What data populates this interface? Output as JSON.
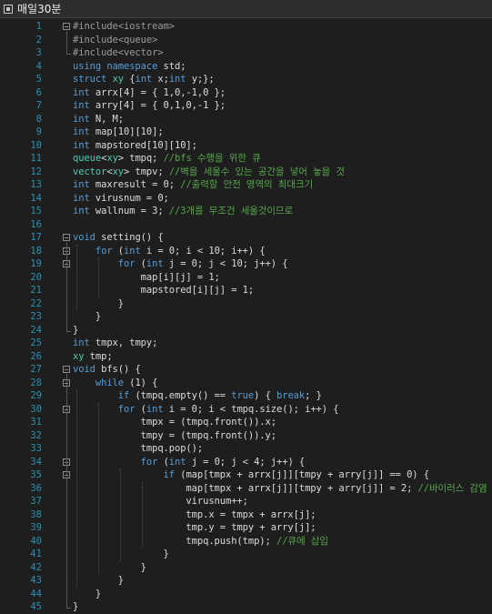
{
  "window": {
    "title": "매일30분"
  },
  "lines": [
    {
      "n": "1",
      "tokens": [
        {
          "t": "#include<iostream>",
          "c": "pp"
        }
      ]
    },
    {
      "n": "2",
      "tokens": [
        {
          "t": "#include<queue>",
          "c": "pp"
        }
      ]
    },
    {
      "n": "3",
      "tokens": [
        {
          "t": "#include<vector>",
          "c": "pp"
        }
      ]
    },
    {
      "n": "4",
      "tokens": [
        {
          "t": "using namespace ",
          "c": "kw"
        },
        {
          "t": "std;",
          "c": "id"
        }
      ]
    },
    {
      "n": "5",
      "tokens": [
        {
          "t": "struct ",
          "c": "kw"
        },
        {
          "t": "xy",
          "c": "ty"
        },
        {
          "t": " {",
          "c": "id"
        },
        {
          "t": "int ",
          "c": "kw"
        },
        {
          "t": "x;",
          "c": "id"
        },
        {
          "t": "int ",
          "c": "kw"
        },
        {
          "t": "y;};",
          "c": "id"
        }
      ]
    },
    {
      "n": "6",
      "tokens": [
        {
          "t": "int ",
          "c": "kw"
        },
        {
          "t": "arrx[4] = { 1,0,-1,0 };",
          "c": "id"
        }
      ]
    },
    {
      "n": "7",
      "tokens": [
        {
          "t": "int ",
          "c": "kw"
        },
        {
          "t": "arry[4] = { 0,1,0,-1 };",
          "c": "id"
        }
      ]
    },
    {
      "n": "8",
      "tokens": [
        {
          "t": "int ",
          "c": "kw"
        },
        {
          "t": "N, M;",
          "c": "id"
        }
      ]
    },
    {
      "n": "9",
      "tokens": [
        {
          "t": "int ",
          "c": "kw"
        },
        {
          "t": "map[10][10];",
          "c": "id"
        }
      ]
    },
    {
      "n": "10",
      "tokens": [
        {
          "t": "int ",
          "c": "kw"
        },
        {
          "t": "mapstored[10][10];",
          "c": "id"
        }
      ]
    },
    {
      "n": "11",
      "tokens": [
        {
          "t": "queue",
          "c": "ty"
        },
        {
          "t": "<",
          "c": "id"
        },
        {
          "t": "xy",
          "c": "ty"
        },
        {
          "t": "> tmpq; ",
          "c": "id"
        },
        {
          "t": "//bfs 수행을 위한 큐",
          "c": "cm"
        }
      ]
    },
    {
      "n": "12",
      "tokens": [
        {
          "t": "vector",
          "c": "ty"
        },
        {
          "t": "<",
          "c": "id"
        },
        {
          "t": "xy",
          "c": "ty"
        },
        {
          "t": "> tmpv; ",
          "c": "id"
        },
        {
          "t": "//벽을 세울수 있는 공간을 넣어 놓을 것",
          "c": "cm"
        }
      ]
    },
    {
      "n": "13",
      "tokens": [
        {
          "t": "int ",
          "c": "kw"
        },
        {
          "t": "maxresult = 0; ",
          "c": "id"
        },
        {
          "t": "//출력할 안전 영역의 최대크기",
          "c": "cm"
        }
      ]
    },
    {
      "n": "14",
      "tokens": [
        {
          "t": "int ",
          "c": "kw"
        },
        {
          "t": "virusnum = 0;",
          "c": "id"
        }
      ]
    },
    {
      "n": "15",
      "tokens": [
        {
          "t": "int ",
          "c": "kw"
        },
        {
          "t": "wallnum = 3; ",
          "c": "id"
        },
        {
          "t": "//3개를 무조건 세울것이므로",
          "c": "cm"
        }
      ]
    },
    {
      "n": "16",
      "tokens": []
    },
    {
      "n": "17",
      "tokens": [
        {
          "t": "void ",
          "c": "kw"
        },
        {
          "t": "setting() {",
          "c": "id"
        }
      ]
    },
    {
      "n": "18",
      "tokens": [
        {
          "t": "    ",
          "c": "id"
        },
        {
          "t": "for ",
          "c": "kw"
        },
        {
          "t": "(",
          "c": "id"
        },
        {
          "t": "int ",
          "c": "kw"
        },
        {
          "t": "i = 0; i < 10; i++) {",
          "c": "id"
        }
      ]
    },
    {
      "n": "19",
      "tokens": [
        {
          "t": "        ",
          "c": "id"
        },
        {
          "t": "for ",
          "c": "kw"
        },
        {
          "t": "(",
          "c": "id"
        },
        {
          "t": "int ",
          "c": "kw"
        },
        {
          "t": "j = 0; j < 10; j++) {",
          "c": "id"
        }
      ]
    },
    {
      "n": "20",
      "tokens": [
        {
          "t": "            map[i][j] = 1;",
          "c": "id"
        }
      ]
    },
    {
      "n": "21",
      "tokens": [
        {
          "t": "            mapstored[i][j] = 1;",
          "c": "id"
        }
      ]
    },
    {
      "n": "22",
      "tokens": [
        {
          "t": "        }",
          "c": "id"
        }
      ]
    },
    {
      "n": "23",
      "tokens": [
        {
          "t": "    }",
          "c": "id"
        }
      ]
    },
    {
      "n": "24",
      "tokens": [
        {
          "t": "}",
          "c": "id"
        }
      ]
    },
    {
      "n": "25",
      "tokens": [
        {
          "t": "int ",
          "c": "kw"
        },
        {
          "t": "tmpx, tmpy;",
          "c": "id"
        }
      ]
    },
    {
      "n": "26",
      "tokens": [
        {
          "t": "xy",
          "c": "ty"
        },
        {
          "t": " tmp;",
          "c": "id"
        }
      ]
    },
    {
      "n": "27",
      "tokens": [
        {
          "t": "void ",
          "c": "kw"
        },
        {
          "t": "bfs() {",
          "c": "id"
        }
      ]
    },
    {
      "n": "28",
      "tokens": [
        {
          "t": "    ",
          "c": "id"
        },
        {
          "t": "while ",
          "c": "kw"
        },
        {
          "t": "(1) {",
          "c": "id"
        }
      ]
    },
    {
      "n": "29",
      "tokens": [
        {
          "t": "        ",
          "c": "id"
        },
        {
          "t": "if ",
          "c": "kw"
        },
        {
          "t": "(tmpq.empty() == ",
          "c": "id"
        },
        {
          "t": "true",
          "c": "kw"
        },
        {
          "t": ") { ",
          "c": "id"
        },
        {
          "t": "break",
          "c": "kw"
        },
        {
          "t": "; }",
          "c": "id"
        }
      ]
    },
    {
      "n": "30",
      "tokens": [
        {
          "t": "        ",
          "c": "id"
        },
        {
          "t": "for ",
          "c": "kw"
        },
        {
          "t": "(",
          "c": "id"
        },
        {
          "t": "int ",
          "c": "kw"
        },
        {
          "t": "i = 0; i < tmpq.size(); i++) {",
          "c": "id"
        }
      ]
    },
    {
      "n": "31",
      "tokens": [
        {
          "t": "            tmpx = (tmpq.front()).x;",
          "c": "id"
        }
      ]
    },
    {
      "n": "32",
      "tokens": [
        {
          "t": "            tmpy = (tmpq.front()).y;",
          "c": "id"
        }
      ]
    },
    {
      "n": "33",
      "tokens": [
        {
          "t": "            tmpq.pop();",
          "c": "id"
        }
      ]
    },
    {
      "n": "34",
      "tokens": [
        {
          "t": "            ",
          "c": "id"
        },
        {
          "t": "for ",
          "c": "kw"
        },
        {
          "t": "(",
          "c": "id"
        },
        {
          "t": "int ",
          "c": "kw"
        },
        {
          "t": "j = 0; j < 4; j++) {",
          "c": "id"
        }
      ]
    },
    {
      "n": "35",
      "tokens": [
        {
          "t": "                ",
          "c": "id"
        },
        {
          "t": "if ",
          "c": "kw"
        },
        {
          "t": "(map[tmpx + arrx[j]][tmpy + arry[j]] == 0) {",
          "c": "id"
        }
      ]
    },
    {
      "n": "36",
      "tokens": [
        {
          "t": "                    map[tmpx + arrx[j]][tmpy + arry[j]] = 2; ",
          "c": "id"
        },
        {
          "t": "//바이러스 감염",
          "c": "cm"
        }
      ]
    },
    {
      "n": "37",
      "tokens": [
        {
          "t": "                    virusnum++;",
          "c": "id"
        }
      ]
    },
    {
      "n": "38",
      "tokens": [
        {
          "t": "                    tmp.x = tmpx + arrx[j];",
          "c": "id"
        }
      ]
    },
    {
      "n": "39",
      "tokens": [
        {
          "t": "                    tmp.y = tmpy + arry[j];",
          "c": "id"
        }
      ]
    },
    {
      "n": "40",
      "tokens": [
        {
          "t": "                    tmpq.push(tmp); ",
          "c": "id"
        },
        {
          "t": "//큐에 삽입",
          "c": "cm"
        }
      ]
    },
    {
      "n": "41",
      "tokens": [
        {
          "t": "                }",
          "c": "id"
        }
      ]
    },
    {
      "n": "42",
      "tokens": [
        {
          "t": "            }",
          "c": "id"
        }
      ]
    },
    {
      "n": "43",
      "tokens": [
        {
          "t": "        }",
          "c": "id"
        }
      ]
    },
    {
      "n": "44",
      "tokens": [
        {
          "t": "    }",
          "c": "id"
        }
      ]
    },
    {
      "n": "45",
      "tokens": [
        {
          "t": "}",
          "c": "id"
        }
      ]
    }
  ],
  "fold_lines": [
    "1",
    "17",
    "18",
    "19",
    "27",
    "28",
    "30",
    "34",
    "35"
  ],
  "colors": {
    "background": "#1e1e1e",
    "line_number": "#2b91af",
    "keyword": "#569cd6",
    "type": "#4ec9b0",
    "comment": "#57a64a",
    "preprocessor": "#9b9b9b",
    "text": "#dcdcdc"
  }
}
